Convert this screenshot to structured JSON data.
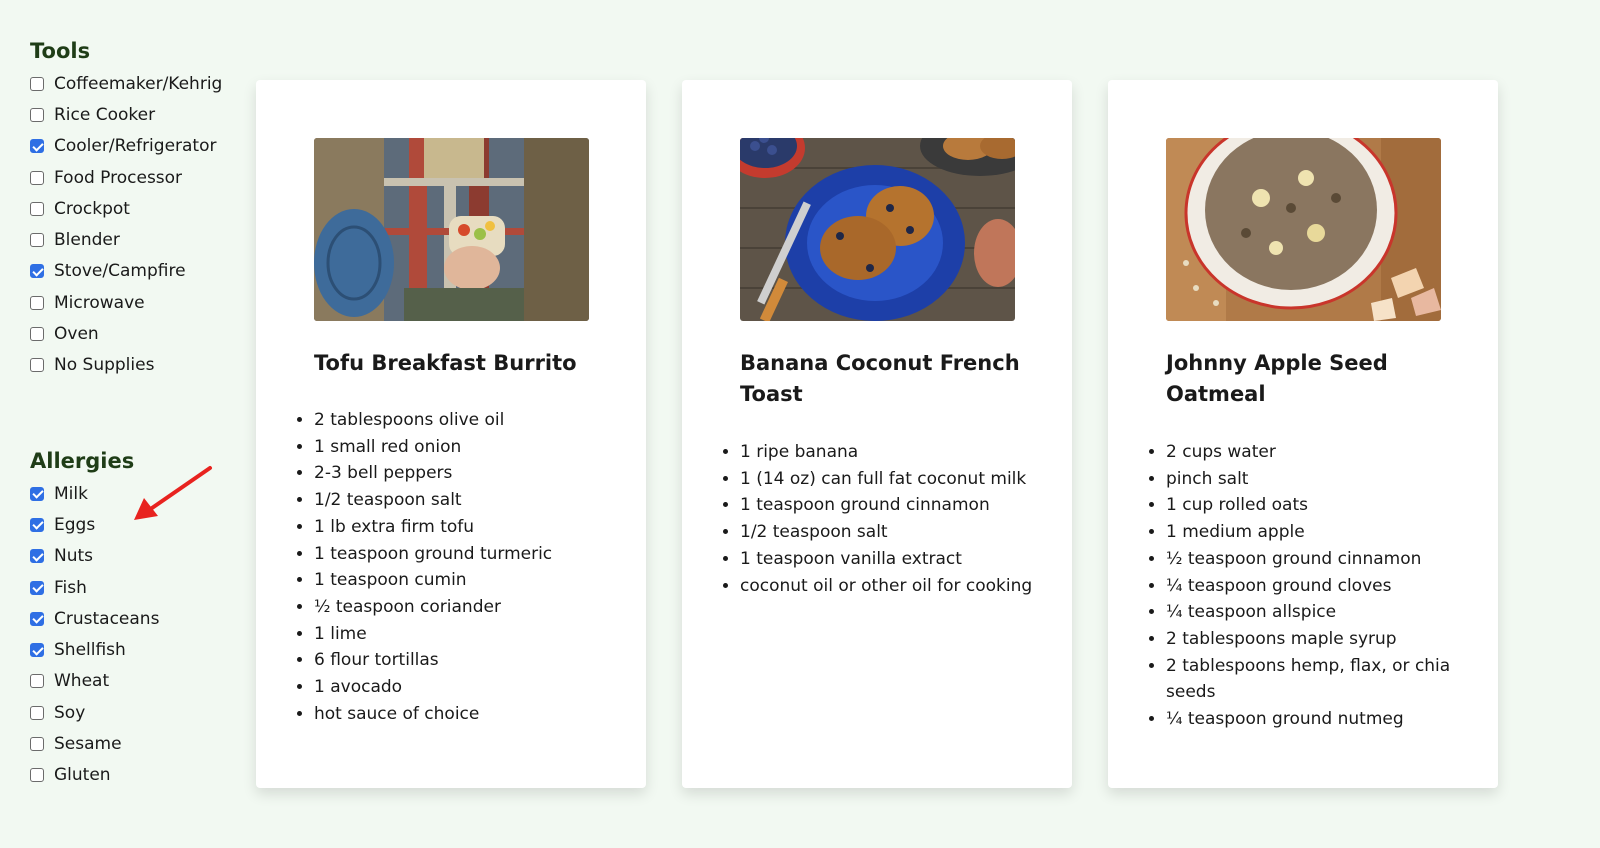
{
  "tools": {
    "title": "Tools",
    "items": [
      {
        "label": "Coffeemaker/Kehrig",
        "checked": false
      },
      {
        "label": "Rice Cooker",
        "checked": false
      },
      {
        "label": "Cooler/Refrigerator",
        "checked": true
      },
      {
        "label": "Food Processor",
        "checked": false
      },
      {
        "label": "Crockpot",
        "checked": false
      },
      {
        "label": "Blender",
        "checked": false
      },
      {
        "label": "Stove/Campfire",
        "checked": true
      },
      {
        "label": "Microwave",
        "checked": false
      },
      {
        "label": "Oven",
        "checked": false
      },
      {
        "label": "No Supplies",
        "checked": false
      }
    ]
  },
  "allergies": {
    "title": "Allergies",
    "items": [
      {
        "label": "Milk",
        "checked": true
      },
      {
        "label": "Eggs",
        "checked": true
      },
      {
        "label": "Nuts",
        "checked": true
      },
      {
        "label": "Fish",
        "checked": true
      },
      {
        "label": "Crustaceans",
        "checked": true
      },
      {
        "label": "Shellfish",
        "checked": true
      },
      {
        "label": "Wheat",
        "checked": false
      },
      {
        "label": "Soy",
        "checked": false
      },
      {
        "label": "Sesame",
        "checked": false
      },
      {
        "label": "Gluten",
        "checked": false
      }
    ]
  },
  "recipes": [
    {
      "title": "Tofu Breakfast Burrito",
      "image": "burrito-photo",
      "ingredients": [
        "2 tablespoons olive oil",
        "1 small red onion",
        "2-3 bell peppers",
        "1/2 teaspoon salt",
        "1 lb extra firm tofu",
        "1 teaspoon ground turmeric",
        "1 teaspoon cumin",
        "½ teaspoon coriander",
        "1 lime",
        "6 flour tortillas",
        "1 avocado",
        "hot sauce of choice"
      ]
    },
    {
      "title": "Banana Coconut French Toast",
      "image": "french-toast-photo",
      "ingredients": [
        "1 ripe banana",
        "1 (14 oz) can full fat coconut milk",
        "1 teaspoon ground cinnamon",
        "1/2 teaspoon salt",
        "1 teaspoon vanilla extract",
        "coconut oil or other oil for cooking"
      ]
    },
    {
      "title": "Johnny Apple Seed Oatmeal",
      "image": "oatmeal-photo",
      "ingredients": [
        "2 cups water",
        "pinch salt",
        "1 cup rolled oats",
        "1 medium apple",
        "½ teaspoon ground cinnamon",
        "¼ teaspoon ground cloves",
        "¼ teaspoon allspice",
        "2 tablespoons maple syrup",
        "2 tablespoons hemp, flax, or chia seeds",
        "¼ teaspoon ground nutmeg"
      ]
    }
  ],
  "colors": {
    "background": "#f2f9f2",
    "heading": "#1f3d17",
    "checkbox_checked": "#2f6fe4",
    "annotation_arrow": "#e8231f"
  }
}
